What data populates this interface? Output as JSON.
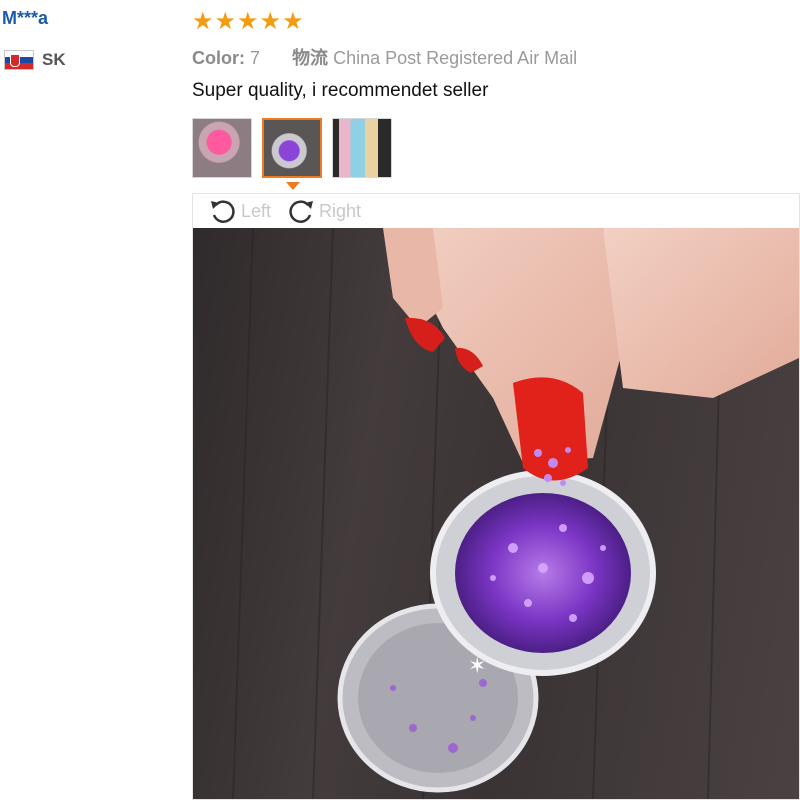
{
  "review": {
    "user": "M***a",
    "country_code": "SK",
    "rating": 5,
    "stars": [
      "★",
      "★",
      "★",
      "★",
      "★"
    ],
    "color_label": "Color:",
    "color_value": "7",
    "shipping_label": "物流",
    "shipping_value": "China Post Registered Air Mail",
    "text": "Super quality, i recommendet seller",
    "thumbnails": [
      {
        "name": "pink-glitter-jar"
      },
      {
        "name": "purple-glitter-jar",
        "selected": true
      },
      {
        "name": "glitter-jar-set"
      }
    ]
  },
  "viewer": {
    "rotate_left": "Left",
    "rotate_right": "Right"
  },
  "colors": {
    "accent": "#f07a1e",
    "star": "#f39c12",
    "link": "#1a5aa8"
  }
}
